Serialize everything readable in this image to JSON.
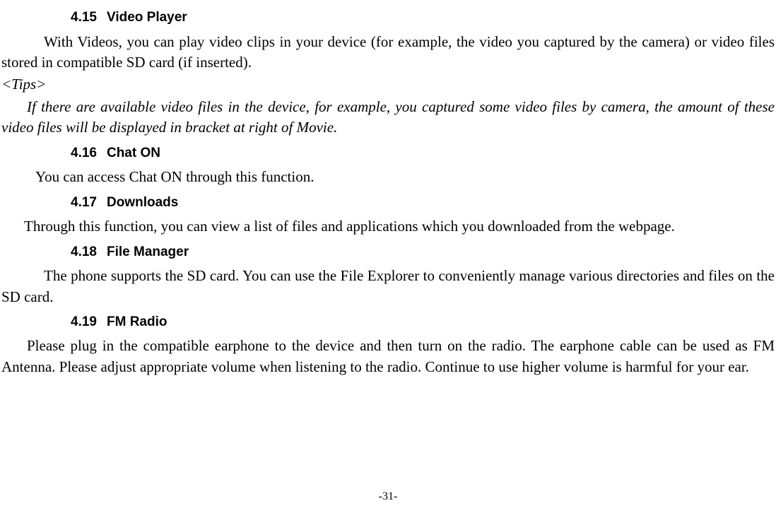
{
  "sections": {
    "s415": {
      "num": "4.15",
      "title": "Video Player",
      "body": "With Videos, you can play video clips in your device (for example, the video you captured by the camera) or video files stored in compatible SD card (if inserted).",
      "tips_label": "<Tips>",
      "tips_body": "If there are available video files in the device, for example, you captured some video files by camera, the amount of these video files will be displayed in bracket at right of Movie."
    },
    "s416": {
      "num": "4.16",
      "title": "Chat ON",
      "body": "You can access Chat ON through this function."
    },
    "s417": {
      "num": "4.17",
      "title": "Downloads",
      "body": "Through this function, you can view a list of files and applications which you downloaded from the webpage."
    },
    "s418": {
      "num": "4.18",
      "title": "File Manager",
      "body": "The phone supports the SD card. You can use the File Explorer to conveniently manage various directories and files on the SD card."
    },
    "s419": {
      "num": "4.19",
      "title": "FM Radio",
      "body": "Please plug in the compatible earphone to the device and then turn on the radio. The earphone cable can be used as FM Antenna. Please adjust appropriate volume when listening to the radio. Continue to use higher volume is harmful for your ear."
    }
  },
  "page_number": "-31-"
}
